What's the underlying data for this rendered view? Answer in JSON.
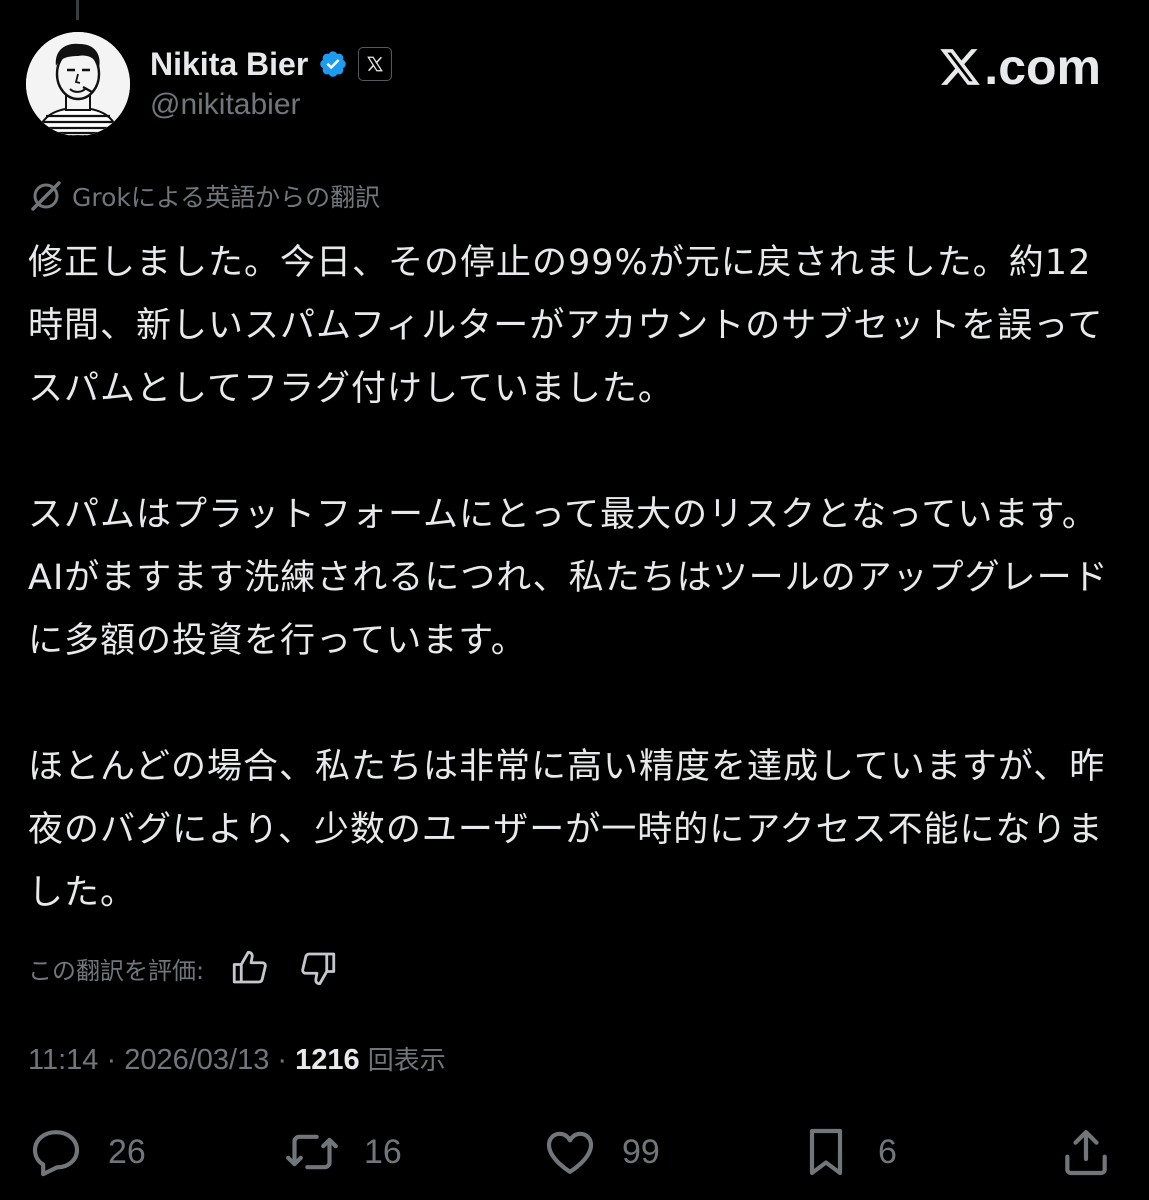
{
  "author": {
    "display_name": "Nikita Bier",
    "handle": "@nikitabier"
  },
  "watermark": {
    "text": ".com"
  },
  "translation": {
    "label": "Grokによる英語からの翻訳"
  },
  "tweet": {
    "paragraphs": [
      "修正しました。今日、その停止の99%が元に戻されました。約12時間、新しいスパムフィルターがアカウントのサブセットを誤ってスパムとしてフラグ付けしていました。",
      "スパムはプラットフォームにとって最大のリスクとなっています。AIがますます洗練されるにつれ、私たちはツールのアップグレードに多額の投資を行っています。",
      "ほとんどの場合、私たちは非常に高い精度を達成していますが、昨夜のバグにより、少数のユーザーが一時的にアクセス不能になりました。"
    ]
  },
  "rating": {
    "label": "この翻訳を評価:"
  },
  "meta": {
    "time": "11:14",
    "sep1": " · ",
    "date": "2026/03/13",
    "sep2": " · ",
    "views_count": "1216",
    "views_label": "回表示"
  },
  "actions": {
    "replies": "26",
    "reposts": "16",
    "likes": "99",
    "bookmarks": "6"
  },
  "colors": {
    "background": "#000000",
    "text_primary": "#e7e9ea",
    "text_secondary": "#71767b",
    "verified": "#1d9bf0"
  },
  "icons": {
    "verified": "verified-badge-icon",
    "affiliation": "x-logo-icon",
    "grok": "grok-icon",
    "thumbs_up": "thumbs-up-icon",
    "thumbs_down": "thumbs-down-icon",
    "reply": "reply-icon",
    "repost": "repost-icon",
    "like": "heart-icon",
    "bookmark": "bookmark-icon",
    "share": "share-icon"
  }
}
